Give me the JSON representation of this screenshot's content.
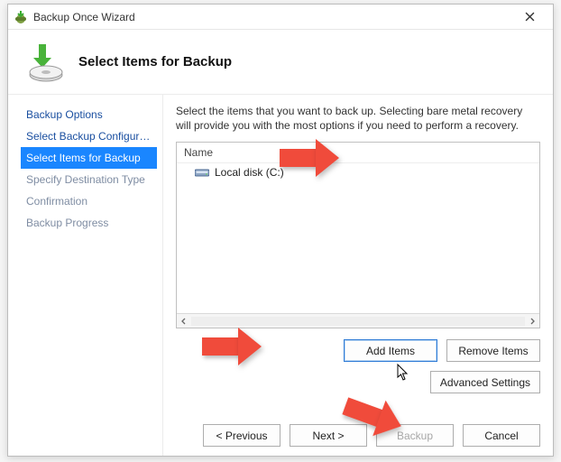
{
  "window": {
    "title": "Backup Once Wizard"
  },
  "header": {
    "heading": "Select Items for Backup"
  },
  "sidebar": {
    "steps": [
      {
        "label": "Backup Options",
        "state": "link"
      },
      {
        "label": "Select Backup Configurat...",
        "state": "link"
      },
      {
        "label": "Select Items for Backup",
        "state": "active"
      },
      {
        "label": "Specify Destination Type",
        "state": "disabled"
      },
      {
        "label": "Confirmation",
        "state": "disabled"
      },
      {
        "label": "Backup Progress",
        "state": "disabled"
      }
    ]
  },
  "main": {
    "instructions": "Select the items that you want to back up. Selecting bare metal recovery will provide you with the most options if you need to perform a recovery.",
    "list": {
      "header": "Name",
      "items": [
        {
          "label": "Local disk (C:)"
        }
      ]
    },
    "buttons": {
      "add": "Add Items",
      "remove": "Remove Items",
      "advanced": "Advanced Settings"
    },
    "nav": {
      "prev": "< Previous",
      "next": "Next >",
      "backup": "Backup",
      "cancel": "Cancel"
    }
  },
  "colors": {
    "accent": "#1a86ff",
    "callout": "#f04b3b"
  }
}
